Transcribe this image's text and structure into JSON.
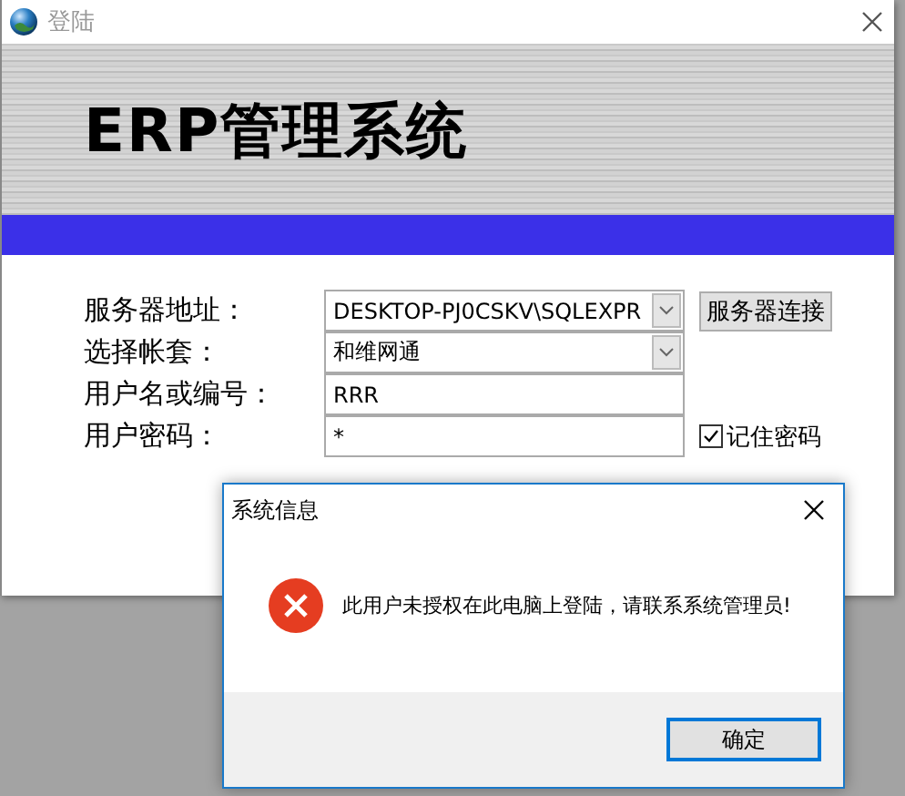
{
  "window": {
    "title": "登陆",
    "banner_title": "ERP管理系统"
  },
  "form": {
    "fields": [
      {
        "kind": "combo",
        "label": "服务器地址：",
        "value": "DESKTOP-PJ0CSKV\\SQLEXPR"
      },
      {
        "kind": "combo",
        "label": "选择帐套：",
        "value": "和维网通"
      },
      {
        "kind": "text",
        "label": "用户名或编号：",
        "value": "RRR"
      },
      {
        "kind": "text",
        "label": "用户密码：",
        "value": "*"
      }
    ],
    "connect_button": "服务器连接",
    "remember_password": {
      "label": "记住密码",
      "checked": true
    }
  },
  "dialog": {
    "title": "系统信息",
    "message": "此用户未授权在此电脑上登陆，请联系系统管理员!",
    "buttons": [
      "确定"
    ]
  }
}
